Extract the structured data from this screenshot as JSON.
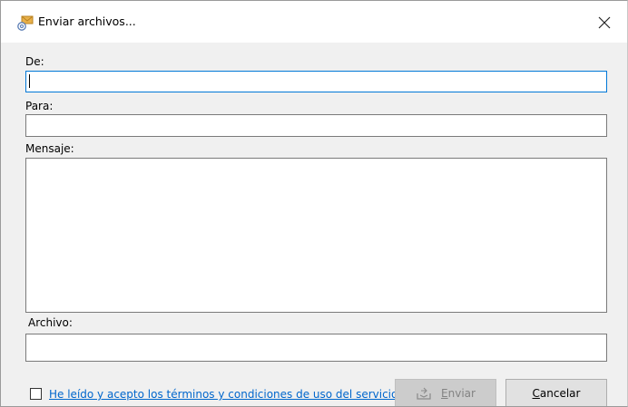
{
  "dialog": {
    "title": "Enviar archivos...",
    "icons": {
      "app": "envelope-at-icon",
      "close": "close-icon",
      "send": "send-tray-icon"
    }
  },
  "form": {
    "from_label": "De:",
    "from_value": "",
    "to_label": "Para:",
    "to_value": "",
    "message_label": "Mensaje:",
    "message_value": "",
    "file_label": "Archivo:",
    "file_value": ""
  },
  "terms": {
    "label": "He leído y acepto los términos y condiciones de uso del servicio",
    "checked": false
  },
  "buttons": {
    "send_label": "Enviar",
    "send_enabled": false,
    "cancel_label": "Cancelar"
  },
  "colors": {
    "focus_border": "#0078d7",
    "link": "#0066cc",
    "disabled_text": "#838383"
  }
}
